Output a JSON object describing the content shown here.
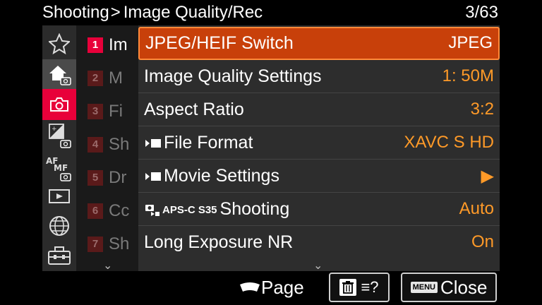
{
  "header": {
    "breadcrumb_root": "Shooting",
    "breadcrumb_sep": ">",
    "breadcrumb_current": "Image Quality/Rec",
    "page_indicator": "3/63"
  },
  "rail": {
    "items": [
      {
        "icon": "star-icon"
      },
      {
        "icon": "home-camera-icon"
      },
      {
        "icon": "camera-icon"
      },
      {
        "icon": "exposure-camera-icon"
      },
      {
        "icon": "af-mf-icon",
        "text_af": "AF",
        "text_mf": "MF"
      },
      {
        "icon": "playback-icon"
      },
      {
        "icon": "globe-icon"
      },
      {
        "icon": "toolbox-icon"
      }
    ]
  },
  "submenu": {
    "items": [
      {
        "num": "1",
        "text": "Im"
      },
      {
        "num": "2",
        "text": "M"
      },
      {
        "num": "3",
        "text": "Fi"
      },
      {
        "num": "4",
        "text": "Sh"
      },
      {
        "num": "5",
        "text": "Dr"
      },
      {
        "num": "6",
        "text": "Cc"
      },
      {
        "num": "7",
        "text": "Sh"
      }
    ]
  },
  "menu": {
    "rows": [
      {
        "label": "JPEG/HEIF Switch",
        "value": "JPEG"
      },
      {
        "label": "Image Quality Settings",
        "value": "1: 50M"
      },
      {
        "label": "Aspect Ratio",
        "value": "3:2"
      },
      {
        "label": "File Format",
        "value": "XAVC S HD"
      },
      {
        "label": "Movie Settings",
        "value": "▶"
      },
      {
        "label": "Shooting",
        "value": "Auto",
        "prefix": "APS-C S35"
      },
      {
        "label": "Long Exposure NR",
        "value": "On"
      }
    ]
  },
  "footer": {
    "page_label": "Page",
    "close_label": "Close",
    "menu_badge": "MENU",
    "help_glyph": "≡?"
  },
  "colors": {
    "accent_red": "#e8003a",
    "selection_orange": "#c8400a",
    "value_orange": "#ff9a28"
  }
}
